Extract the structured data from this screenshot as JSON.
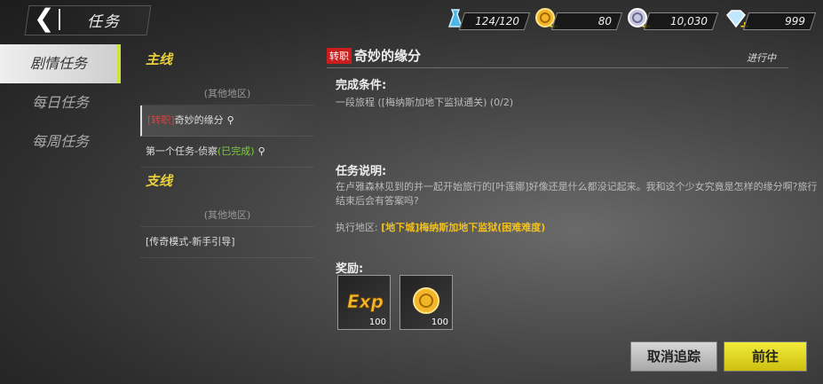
{
  "header": {
    "back_icon": "back-arrow-icon",
    "title": "任务"
  },
  "resources": [
    {
      "icon": "energy-potion-icon",
      "value": "124/120"
    },
    {
      "icon": "gold-coin-icon",
      "value": "80"
    },
    {
      "icon": "silver-coin-icon",
      "value": "10,030"
    },
    {
      "icon": "diamond-icon",
      "value": "999"
    }
  ],
  "sidebar": {
    "items": [
      {
        "label": "剧情任务"
      },
      {
        "label": "每日任务"
      },
      {
        "label": "每周任务"
      }
    ]
  },
  "quests": {
    "main_title": "主线",
    "main_region": "(其他地区)",
    "main_items": [
      {
        "tag": "[转职]",
        "name": "奇妙的缘分"
      },
      {
        "name": "第一个任务-侦察",
        "status": "(已完成)"
      }
    ],
    "side_title": "支线",
    "side_region": "(其他地区)",
    "side_items": [
      {
        "name": "[传奇模式-新手引导]"
      }
    ]
  },
  "detail": {
    "badge": "转职",
    "title": "奇妙的缘分",
    "status": "进行中",
    "condition_label": "完成条件:",
    "condition_text": "一段旅程 ([梅纳斯加地下监狱通关) (0/2)",
    "desc_label": "任务说明:",
    "desc_text": "在卢雅森林见到的并一起开始旅行的[叶莲娜]好像还是什么都没记起来。我和这个少女究竟是怎样的缘分啊?旅行结束后会有答案吗?",
    "area_label": "执行地区:",
    "area_value": "[地下城]梅纳斯加地下监狱(困难难度)",
    "reward_label": "奖励:",
    "rewards": [
      {
        "icon": "exp-icon",
        "icon_text": "Exp",
        "qty": "100"
      },
      {
        "icon": "gold-coin-icon",
        "qty": "100"
      }
    ]
  },
  "buttons": {
    "cancel": "取消追踪",
    "go": "前往"
  }
}
